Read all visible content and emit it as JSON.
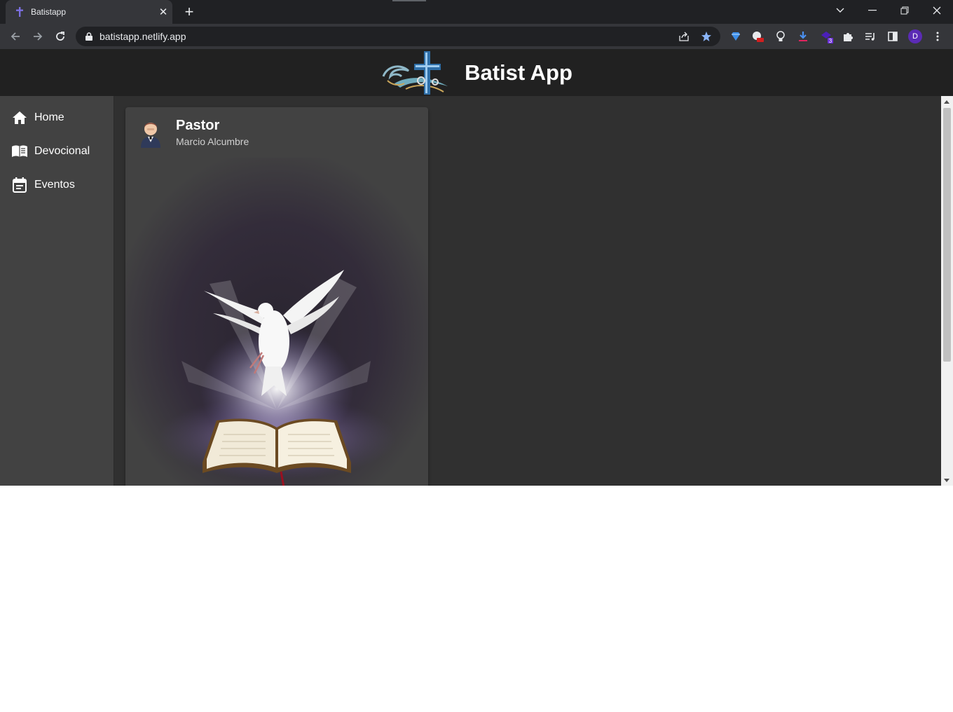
{
  "browser": {
    "tab_title": "Batistapp",
    "tab_close": "✕",
    "new_tab": "+",
    "url": "batistapp.netlify.app",
    "profile_initial": "D",
    "ext_badge": "3"
  },
  "app": {
    "title": "Batist App"
  },
  "sidebar": {
    "items": [
      {
        "label": "Home",
        "icon": "home-icon"
      },
      {
        "label": "Devocional",
        "icon": "book-icon"
      },
      {
        "label": "Eventos",
        "icon": "event-note-icon"
      }
    ]
  },
  "card": {
    "title": "Pastor",
    "subtitle": "Marcio Alcumbre",
    "media_icon": "dove-over-bible-image"
  },
  "colors": {
    "appbar": "#212121",
    "sidebar": "#424242",
    "main": "#303030",
    "card": "#424242"
  }
}
